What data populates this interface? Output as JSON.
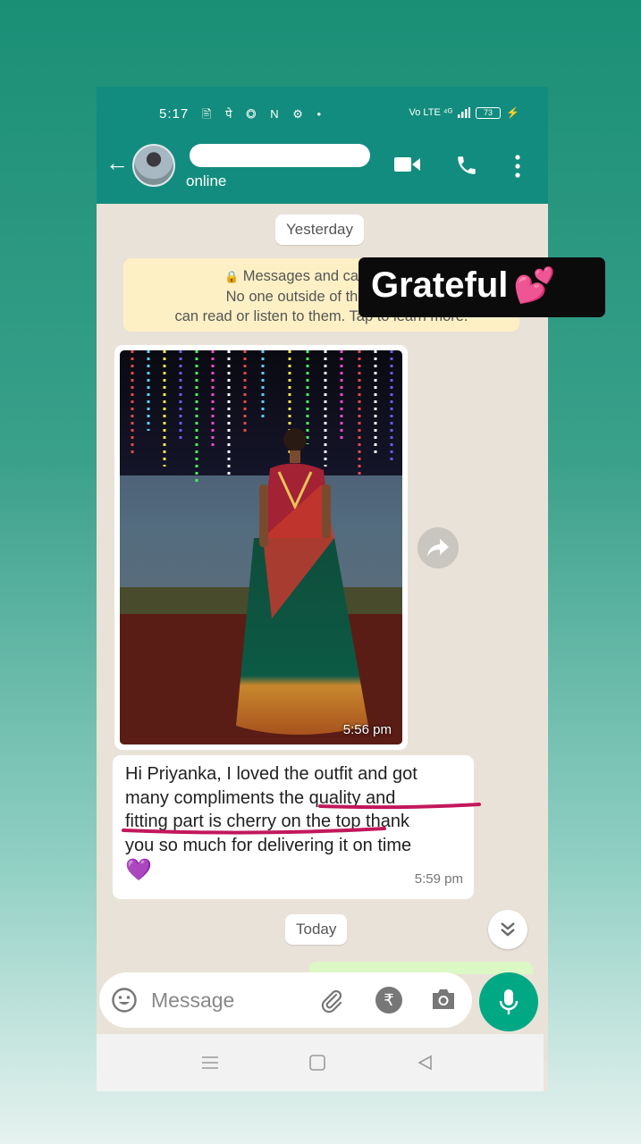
{
  "status_bar": {
    "time": "5:17",
    "left_icons": "🖹 पे ◎ N ⚙ •",
    "network": "Vo LTE ⁴ᴳ",
    "battery": "73"
  },
  "header": {
    "status": "online"
  },
  "chat": {
    "date_yesterday": "Yesterday",
    "encryption_lines": [
      "Messages and calls are en",
      "No one outside of this chat, n",
      "can read or listen to them. Tap to learn more."
    ],
    "image_time": "5:56 pm",
    "message_text": "Hi Priyanka, I loved the outfit and got\nmany compliments the quality and\nfitting part is cherry on the top thank\nyou so much for delivering it on time",
    "message_emoji": "💜",
    "message_time": "5:59 pm",
    "date_today": "Today"
  },
  "input": {
    "placeholder": "Message",
    "rupee_symbol": "₹"
  },
  "sticker": {
    "text": "Grateful",
    "emoji": "💕"
  },
  "colors": {
    "header_green": "#128c7e",
    "mic_green": "#00a884",
    "highlight_magenta": "#c2185b",
    "chat_bg": "#e9e2d8"
  }
}
